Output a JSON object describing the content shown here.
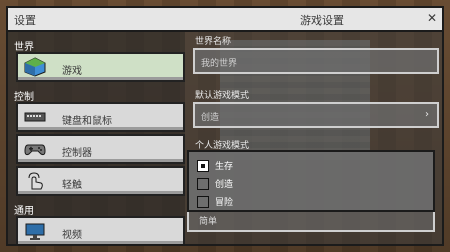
{
  "title_left": "设置",
  "title_center": "游戏设置",
  "left": {
    "sections": [
      "世界",
      "控制",
      "通用"
    ],
    "items": [
      {
        "label": "游戏",
        "icon": "globe-icon",
        "selected": true
      },
      {
        "label": "键盘和鼠标",
        "icon": "keyboard-icon"
      },
      {
        "label": "控制器",
        "icon": "gamepad-icon"
      },
      {
        "label": "轻触",
        "icon": "touch-icon"
      },
      {
        "label": "视频",
        "icon": "monitor-icon"
      }
    ]
  },
  "right": {
    "world_name_label": "世界名称",
    "world_name_value": "我的世界",
    "default_mode_label": "默认游戏模式",
    "default_mode_value": "创造",
    "personal_mode_label": "个人游戏模式",
    "options": [
      {
        "label": "生存",
        "checked": true
      },
      {
        "label": "创造",
        "checked": false
      },
      {
        "label": "冒险",
        "checked": false
      }
    ],
    "under_dropdown_text": "简单"
  },
  "colors": {
    "accent": "#cfe0c6"
  }
}
